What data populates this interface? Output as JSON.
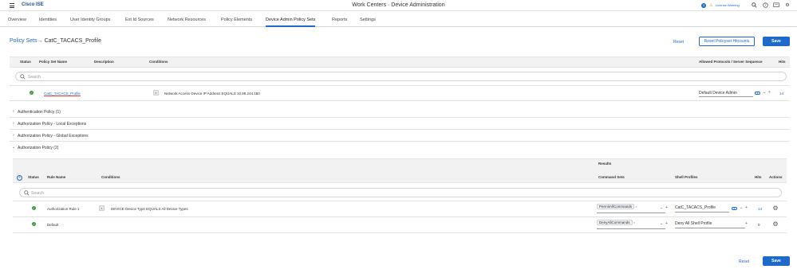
{
  "header": {
    "brand": "Cisco ISE",
    "title": "Work Centers · Device Administration",
    "notif_count": "3",
    "license_warning": "License Warning"
  },
  "nav": {
    "tabs": [
      "Overview",
      "Identities",
      "User Identity Groups",
      "Ext Id Sources",
      "Network Resources",
      "Policy Elements",
      "Device Admin Policy Sets",
      "Reports",
      "Settings"
    ],
    "active": "Device Admin Policy Sets"
  },
  "breadcrumb": {
    "parent": "Policy Sets",
    "arrow": "→",
    "current": "CatC_TACACS_Profile"
  },
  "buttons": {
    "reset": "Reset",
    "reset_hitcounts": "Reset Policyset Hitcounts",
    "save": "Save"
  },
  "policy_set_table": {
    "headers": {
      "status": "Status",
      "name": "Policy Set Name",
      "description": "Description",
      "conditions": "Conditions",
      "protocols": "Allowed Protocols / Server Sequence",
      "hits": "Hits"
    },
    "search_placeholder": "Search",
    "row": {
      "name": "CatC_TACACS_Profile",
      "condition": "Network Access·Device IP Address EQUALS 10.88.244.150",
      "protocol": "Default Device Admin",
      "hits": "14"
    }
  },
  "sections": {
    "authentication": "Authentication Policy (1)",
    "authz_local": "Authorization Policy - Local Exceptions",
    "authz_global": "Authorization Policy - Global Exceptions",
    "authorization": "Authorization Policy (2)"
  },
  "authz_table": {
    "results_label": "Results",
    "headers": {
      "status": "Status",
      "rule_name": "Rule Name",
      "conditions": "Conditions",
      "command_sets": "Command Sets",
      "shell_profiles": "Shell Profiles",
      "hits": "Hits",
      "actions": "Actions"
    },
    "search_placeholder": "Search",
    "rows": [
      {
        "name": "Authorization Rule 1",
        "condition": "DEVICE·Device Type EQUALS All Device Types",
        "command_set": "PermitAllCommands",
        "shell_profile": "CatC_TACACS_Profile",
        "hits": "14"
      },
      {
        "name": "Default",
        "condition": "",
        "command_set": "DenyAllCommands",
        "shell_profile": "Deny All Shell Profile",
        "hits": "0"
      }
    ]
  },
  "icons": {
    "menu": "hamburger-menu-icon",
    "search": "search-icon",
    "help": "help-icon",
    "notifications": "notifications-icon",
    "settings": "gear-icon",
    "status_ok": "check-circle-icon",
    "expand": "chevron-right-icon",
    "collapse": "chevron-down-icon",
    "add": "plus-circle-icon"
  },
  "colors": {
    "accent": "#1d69cc",
    "status_green": "#3a9a3a",
    "warning": "#e3a21a"
  }
}
